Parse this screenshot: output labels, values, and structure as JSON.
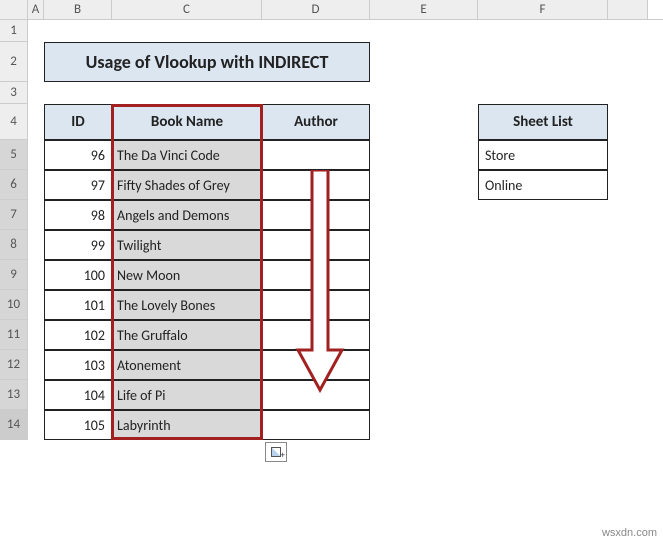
{
  "columns": [
    "A",
    "B",
    "C",
    "D",
    "E",
    "F"
  ],
  "rows": [
    "1",
    "2",
    "3",
    "4",
    "5",
    "6",
    "7",
    "8",
    "9",
    "10",
    "11",
    "12",
    "13",
    "14"
  ],
  "title": "Usage of Vlookup with INDIRECT",
  "main_table": {
    "headers": {
      "id": "ID",
      "book": "Book Name",
      "author": "Author"
    },
    "rows": [
      {
        "id": "96",
        "book": "The Da Vinci Code"
      },
      {
        "id": "97",
        "book": "Fifty Shades of Grey"
      },
      {
        "id": "98",
        "book": "Angels and Demons"
      },
      {
        "id": "99",
        "book": "Twilight"
      },
      {
        "id": "100",
        "book": "New Moon"
      },
      {
        "id": "101",
        "book": "The Lovely Bones"
      },
      {
        "id": "102",
        "book": "The Gruffalo"
      },
      {
        "id": "103",
        "book": "Atonement"
      },
      {
        "id": "104",
        "book": "Life of Pi"
      },
      {
        "id": "105",
        "book": "Labyrinth"
      }
    ]
  },
  "side_table": {
    "header": "Sheet List",
    "rows": [
      "Store",
      "Online"
    ]
  },
  "watermark": "wsxdn.com"
}
